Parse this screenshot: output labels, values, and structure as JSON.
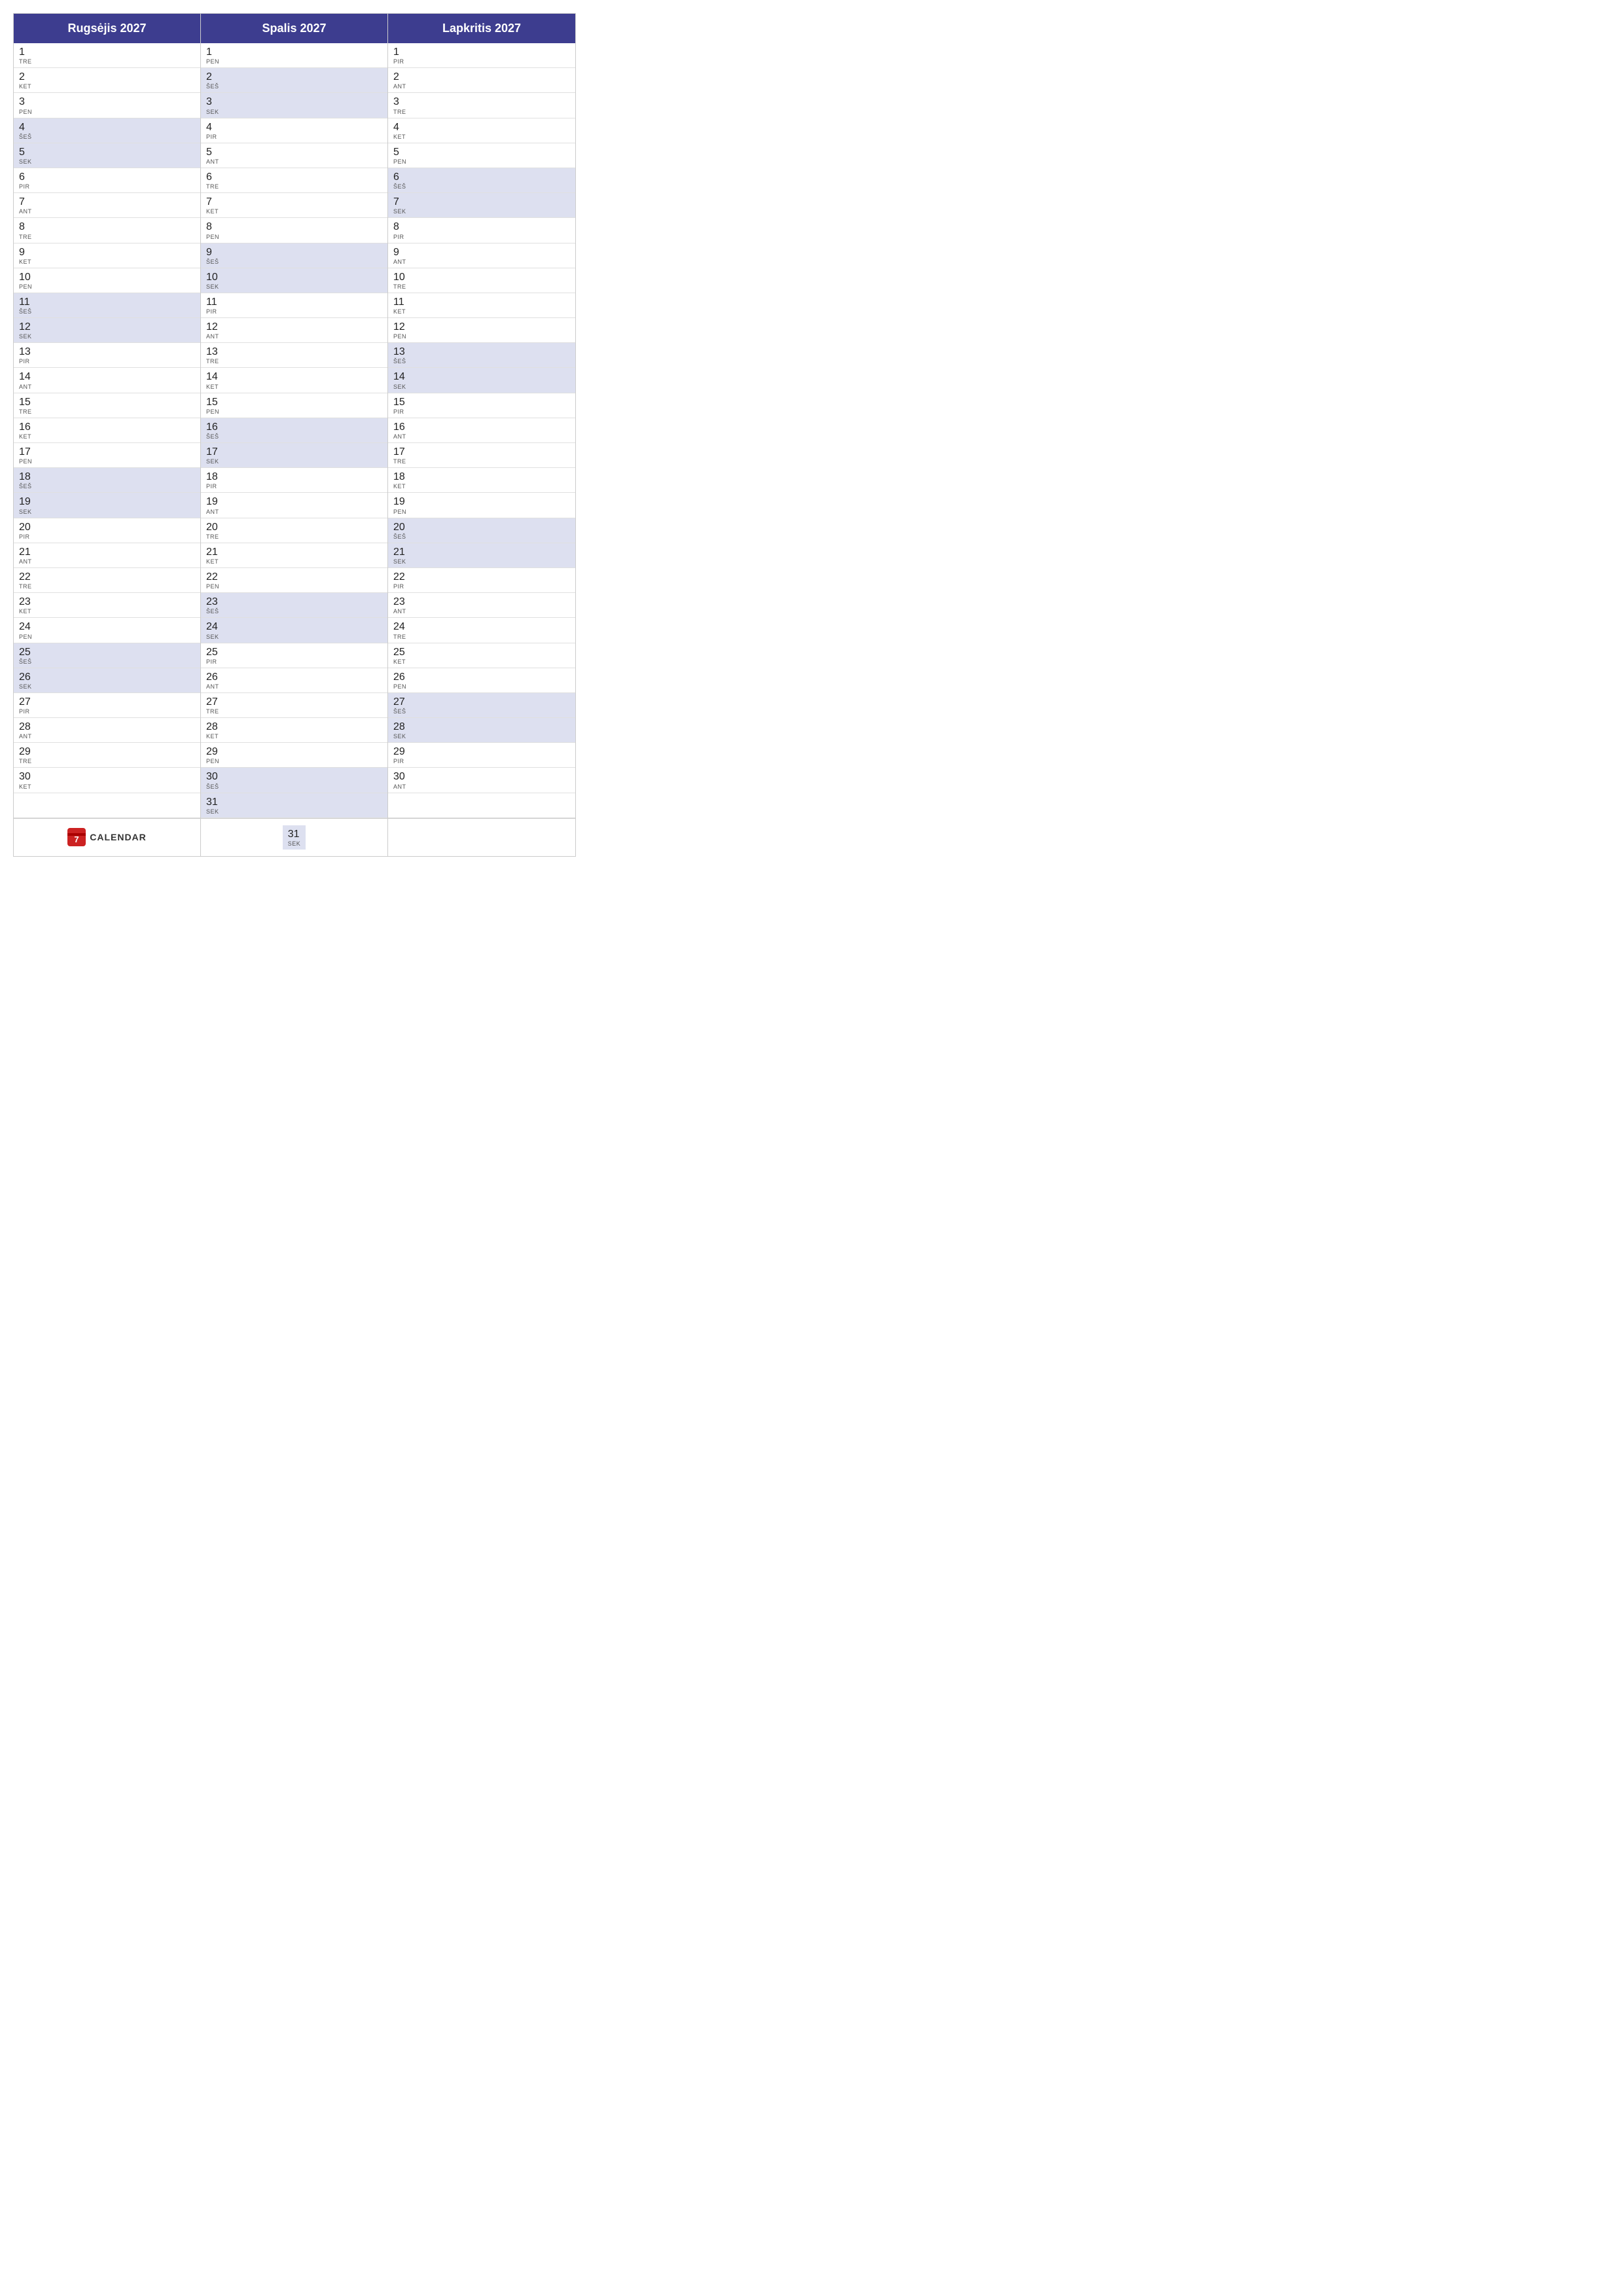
{
  "months": [
    {
      "name": "Rugsėjis 2027",
      "days": [
        {
          "num": "1",
          "name": "TRE",
          "highlight": false
        },
        {
          "num": "2",
          "name": "KET",
          "highlight": false
        },
        {
          "num": "3",
          "name": "PEN",
          "highlight": false
        },
        {
          "num": "4",
          "name": "ŠEŠ",
          "highlight": true
        },
        {
          "num": "5",
          "name": "SEK",
          "highlight": true
        },
        {
          "num": "6",
          "name": "PIR",
          "highlight": false
        },
        {
          "num": "7",
          "name": "ANT",
          "highlight": false
        },
        {
          "num": "8",
          "name": "TRE",
          "highlight": false
        },
        {
          "num": "9",
          "name": "KET",
          "highlight": false
        },
        {
          "num": "10",
          "name": "PEN",
          "highlight": false
        },
        {
          "num": "11",
          "name": "ŠEŠ",
          "highlight": true
        },
        {
          "num": "12",
          "name": "SEK",
          "highlight": true
        },
        {
          "num": "13",
          "name": "PIR",
          "highlight": false
        },
        {
          "num": "14",
          "name": "ANT",
          "highlight": false
        },
        {
          "num": "15",
          "name": "TRE",
          "highlight": false
        },
        {
          "num": "16",
          "name": "KET",
          "highlight": false
        },
        {
          "num": "17",
          "name": "PEN",
          "highlight": false
        },
        {
          "num": "18",
          "name": "ŠEŠ",
          "highlight": true
        },
        {
          "num": "19",
          "name": "SEK",
          "highlight": true
        },
        {
          "num": "20",
          "name": "PIR",
          "highlight": false
        },
        {
          "num": "21",
          "name": "ANT",
          "highlight": false
        },
        {
          "num": "22",
          "name": "TRE",
          "highlight": false
        },
        {
          "num": "23",
          "name": "KET",
          "highlight": false
        },
        {
          "num": "24",
          "name": "PEN",
          "highlight": false
        },
        {
          "num": "25",
          "name": "ŠEŠ",
          "highlight": true
        },
        {
          "num": "26",
          "name": "SEK",
          "highlight": true
        },
        {
          "num": "27",
          "name": "PIR",
          "highlight": false
        },
        {
          "num": "28",
          "name": "ANT",
          "highlight": false
        },
        {
          "num": "29",
          "name": "TRE",
          "highlight": false
        },
        {
          "num": "30",
          "name": "KET",
          "highlight": false
        }
      ],
      "extra_days": 1
    },
    {
      "name": "Spalis 2027",
      "days": [
        {
          "num": "1",
          "name": "PEN",
          "highlight": false
        },
        {
          "num": "2",
          "name": "ŠEŠ",
          "highlight": true
        },
        {
          "num": "3",
          "name": "SEK",
          "highlight": true
        },
        {
          "num": "4",
          "name": "PIR",
          "highlight": false
        },
        {
          "num": "5",
          "name": "ANT",
          "highlight": false
        },
        {
          "num": "6",
          "name": "TRE",
          "highlight": false
        },
        {
          "num": "7",
          "name": "KET",
          "highlight": false
        },
        {
          "num": "8",
          "name": "PEN",
          "highlight": false
        },
        {
          "num": "9",
          "name": "ŠEŠ",
          "highlight": true
        },
        {
          "num": "10",
          "name": "SEK",
          "highlight": true
        },
        {
          "num": "11",
          "name": "PIR",
          "highlight": false
        },
        {
          "num": "12",
          "name": "ANT",
          "highlight": false
        },
        {
          "num": "13",
          "name": "TRE",
          "highlight": false
        },
        {
          "num": "14",
          "name": "KET",
          "highlight": false
        },
        {
          "num": "15",
          "name": "PEN",
          "highlight": false
        },
        {
          "num": "16",
          "name": "ŠEŠ",
          "highlight": true
        },
        {
          "num": "17",
          "name": "SEK",
          "highlight": true
        },
        {
          "num": "18",
          "name": "PIR",
          "highlight": false
        },
        {
          "num": "19",
          "name": "ANT",
          "highlight": false
        },
        {
          "num": "20",
          "name": "TRE",
          "highlight": false
        },
        {
          "num": "21",
          "name": "KET",
          "highlight": false
        },
        {
          "num": "22",
          "name": "PEN",
          "highlight": false
        },
        {
          "num": "23",
          "name": "ŠEŠ",
          "highlight": true
        },
        {
          "num": "24",
          "name": "SEK",
          "highlight": true
        },
        {
          "num": "25",
          "name": "PIR",
          "highlight": false
        },
        {
          "num": "26",
          "name": "ANT",
          "highlight": false
        },
        {
          "num": "27",
          "name": "TRE",
          "highlight": false
        },
        {
          "num": "28",
          "name": "KET",
          "highlight": false
        },
        {
          "num": "29",
          "name": "PEN",
          "highlight": false
        },
        {
          "num": "30",
          "name": "ŠEŠ",
          "highlight": true
        },
        {
          "num": "31",
          "name": "SEK",
          "highlight": true
        }
      ],
      "extra_days": 0
    },
    {
      "name": "Lapkritis 2027",
      "days": [
        {
          "num": "1",
          "name": "PIR",
          "highlight": false
        },
        {
          "num": "2",
          "name": "ANT",
          "highlight": false
        },
        {
          "num": "3",
          "name": "TRE",
          "highlight": false
        },
        {
          "num": "4",
          "name": "KET",
          "highlight": false
        },
        {
          "num": "5",
          "name": "PEN",
          "highlight": false
        },
        {
          "num": "6",
          "name": "ŠEŠ",
          "highlight": true
        },
        {
          "num": "7",
          "name": "SEK",
          "highlight": true
        },
        {
          "num": "8",
          "name": "PIR",
          "highlight": false
        },
        {
          "num": "9",
          "name": "ANT",
          "highlight": false
        },
        {
          "num": "10",
          "name": "TRE",
          "highlight": false
        },
        {
          "num": "11",
          "name": "KET",
          "highlight": false
        },
        {
          "num": "12",
          "name": "PEN",
          "highlight": false
        },
        {
          "num": "13",
          "name": "ŠEŠ",
          "highlight": true
        },
        {
          "num": "14",
          "name": "SEK",
          "highlight": true
        },
        {
          "num": "15",
          "name": "PIR",
          "highlight": false
        },
        {
          "num": "16",
          "name": "ANT",
          "highlight": false
        },
        {
          "num": "17",
          "name": "TRE",
          "highlight": false
        },
        {
          "num": "18",
          "name": "KET",
          "highlight": false
        },
        {
          "num": "19",
          "name": "PEN",
          "highlight": false
        },
        {
          "num": "20",
          "name": "ŠEŠ",
          "highlight": true
        },
        {
          "num": "21",
          "name": "SEK",
          "highlight": true
        },
        {
          "num": "22",
          "name": "PIR",
          "highlight": false
        },
        {
          "num": "23",
          "name": "ANT",
          "highlight": false
        },
        {
          "num": "24",
          "name": "TRE",
          "highlight": false
        },
        {
          "num": "25",
          "name": "KET",
          "highlight": false
        },
        {
          "num": "26",
          "name": "PEN",
          "highlight": false
        },
        {
          "num": "27",
          "name": "ŠEŠ",
          "highlight": true
        },
        {
          "num": "28",
          "name": "SEK",
          "highlight": true
        },
        {
          "num": "29",
          "name": "PIR",
          "highlight": false
        },
        {
          "num": "30",
          "name": "ANT",
          "highlight": false
        }
      ],
      "extra_days": 0
    }
  ],
  "footer": {
    "logo_text": "CALENDAR",
    "logo_icon_color": "#cc2222"
  }
}
